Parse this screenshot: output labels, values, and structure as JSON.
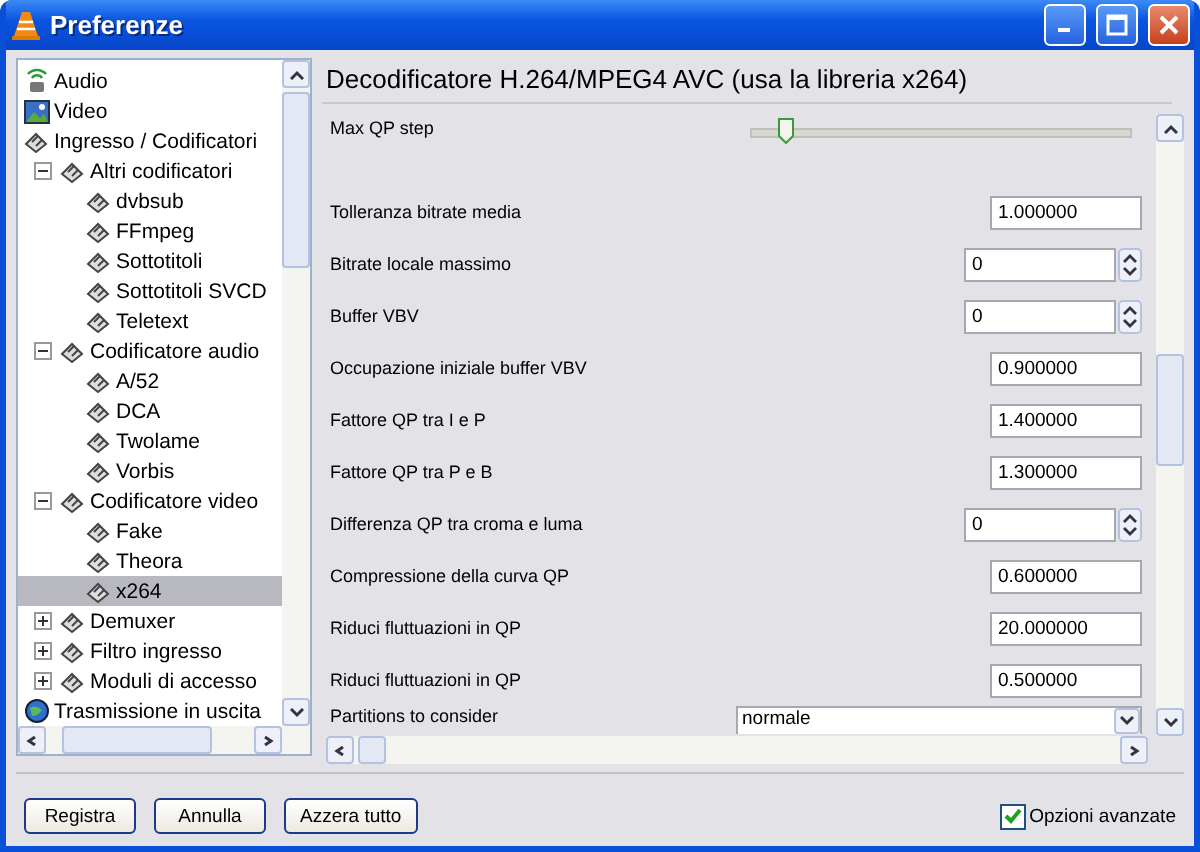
{
  "window": {
    "title": "Preferenze"
  },
  "tree": [
    {
      "label": "Audio",
      "kind": "audio",
      "selected": false
    },
    {
      "label": "Video",
      "kind": "video",
      "selected": false
    },
    {
      "label": "Ingresso / Codificatori",
      "kind": "module",
      "selected": false,
      "children": [
        {
          "label": "Altri codificatori",
          "kind": "module",
          "selected": false,
          "expanded": true,
          "children": [
            {
              "label": "dvbsub",
              "kind": "module",
              "selected": false
            },
            {
              "label": "FFmpeg",
              "kind": "module",
              "selected": false
            },
            {
              "label": "Sottotitoli",
              "kind": "module",
              "selected": false
            },
            {
              "label": "Sottotitoli SVCD",
              "kind": "module",
              "selected": false
            },
            {
              "label": "Teletext",
              "kind": "module",
              "selected": false
            }
          ]
        },
        {
          "label": "Codificatore audio",
          "kind": "module",
          "selected": false,
          "expanded": true,
          "children": [
            {
              "label": "A/52",
              "kind": "module",
              "selected": false
            },
            {
              "label": "DCA",
              "kind": "module",
              "selected": false
            },
            {
              "label": "Twolame",
              "kind": "module",
              "selected": false
            },
            {
              "label": "Vorbis",
              "kind": "module",
              "selected": false
            }
          ]
        },
        {
          "label": "Codificatore video",
          "kind": "module",
          "selected": false,
          "expanded": true,
          "children": [
            {
              "label": "Fake",
              "kind": "module",
              "selected": false
            },
            {
              "label": "Theora",
              "kind": "module",
              "selected": false
            },
            {
              "label": "x264",
              "kind": "module",
              "selected": true
            }
          ]
        },
        {
          "label": "Demuxer",
          "kind": "module",
          "selected": false,
          "expanded": false
        },
        {
          "label": "Filtro ingresso",
          "kind": "module",
          "selected": false,
          "expanded": false
        },
        {
          "label": "Moduli di accesso",
          "kind": "module",
          "selected": false,
          "expanded": false
        }
      ]
    },
    {
      "label": "Trasmissione in uscita",
      "kind": "stream",
      "selected": false
    }
  ],
  "panel": {
    "title": "Decodificatore H.264/MPEG4 AVC (usa la libreria x264)",
    "settings": [
      {
        "kind": "slider",
        "label": "Max QP step",
        "level": 0.09
      },
      {
        "kind": "float",
        "label": "Tolleranza bitrate media",
        "value": "1.000000"
      },
      {
        "kind": "int",
        "label": "Bitrate locale massimo",
        "value": "0"
      },
      {
        "kind": "int",
        "label": "Buffer VBV",
        "value": "0"
      },
      {
        "kind": "float",
        "label": "Occupazione iniziale buffer VBV",
        "value": "0.900000"
      },
      {
        "kind": "float",
        "label": "Fattore QP tra I e P",
        "value": "1.400000"
      },
      {
        "kind": "float",
        "label": "Fattore QP tra P e B",
        "value": "1.300000"
      },
      {
        "kind": "int",
        "label": "Differenza QP tra croma e luma",
        "value": "0"
      },
      {
        "kind": "float",
        "label": "Compressione della curva QP",
        "value": "0.600000"
      },
      {
        "kind": "float",
        "label": "Riduci fluttuazioni in QP",
        "value": "20.000000"
      },
      {
        "kind": "float",
        "label": "Riduci fluttuazioni in QP",
        "value": "0.500000"
      },
      {
        "kind": "select",
        "label": "Partitions to consider",
        "value": "normale"
      }
    ]
  },
  "buttons": [
    "Registra",
    "Annulla",
    "Azzera tutto"
  ],
  "advanced": {
    "label": "Opzioni avanzate",
    "checked": true
  }
}
